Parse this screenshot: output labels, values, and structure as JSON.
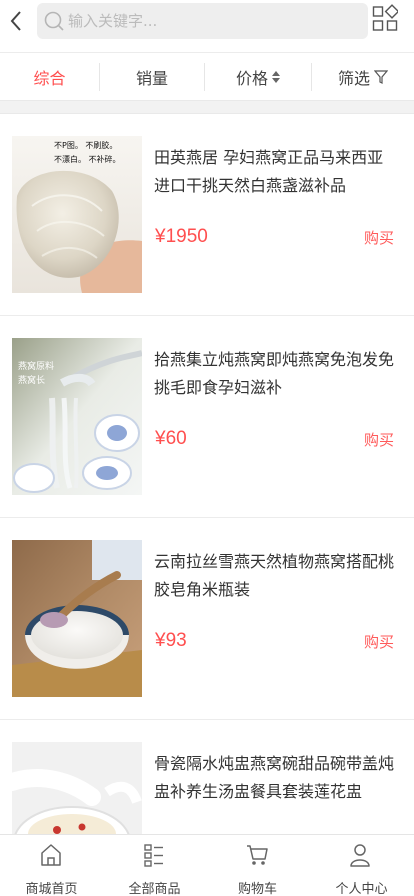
{
  "search": {
    "placeholder": "输入关键字..."
  },
  "sort": {
    "items": [
      {
        "label": "综合",
        "active": true
      },
      {
        "label": "销量"
      },
      {
        "label": "价格"
      },
      {
        "label": "筛选"
      }
    ]
  },
  "products": [
    {
      "title": "田英燕居 孕妇燕窝正品马来西亚进口干挑天然白燕盏滋补品",
      "price": "¥1950",
      "buy": "购买",
      "image_text": [
        "不P图。 不刷胶。",
        "不漂白。 不补碎。"
      ]
    },
    {
      "title": "拾燕集立炖燕窝即炖燕窝免泡发免挑毛即食孕妇滋补",
      "price": "¥60",
      "buy": "购买",
      "image_text": [
        "燕窝原料",
        "燕窝长"
      ]
    },
    {
      "title": "云南拉丝雪燕天然植物燕窝搭配桃胶皂角米瓶装",
      "price": "¥93",
      "buy": "购买"
    },
    {
      "title": "骨瓷隔水炖盅燕窝碗甜品碗带盖炖盅补养生汤盅餐具套装莲花盅",
      "price": "",
      "buy": ""
    }
  ],
  "tabbar": {
    "items": [
      {
        "label": "商城首页",
        "icon": "home-icon"
      },
      {
        "label": "全部商品",
        "icon": "list-icon"
      },
      {
        "label": "购物车",
        "icon": "cart-icon"
      },
      {
        "label": "个人中心",
        "icon": "person-icon"
      }
    ]
  },
  "colors": {
    "accent": "#ff4f4f",
    "divider": "#ececec",
    "search_bg": "#eeeeee"
  }
}
